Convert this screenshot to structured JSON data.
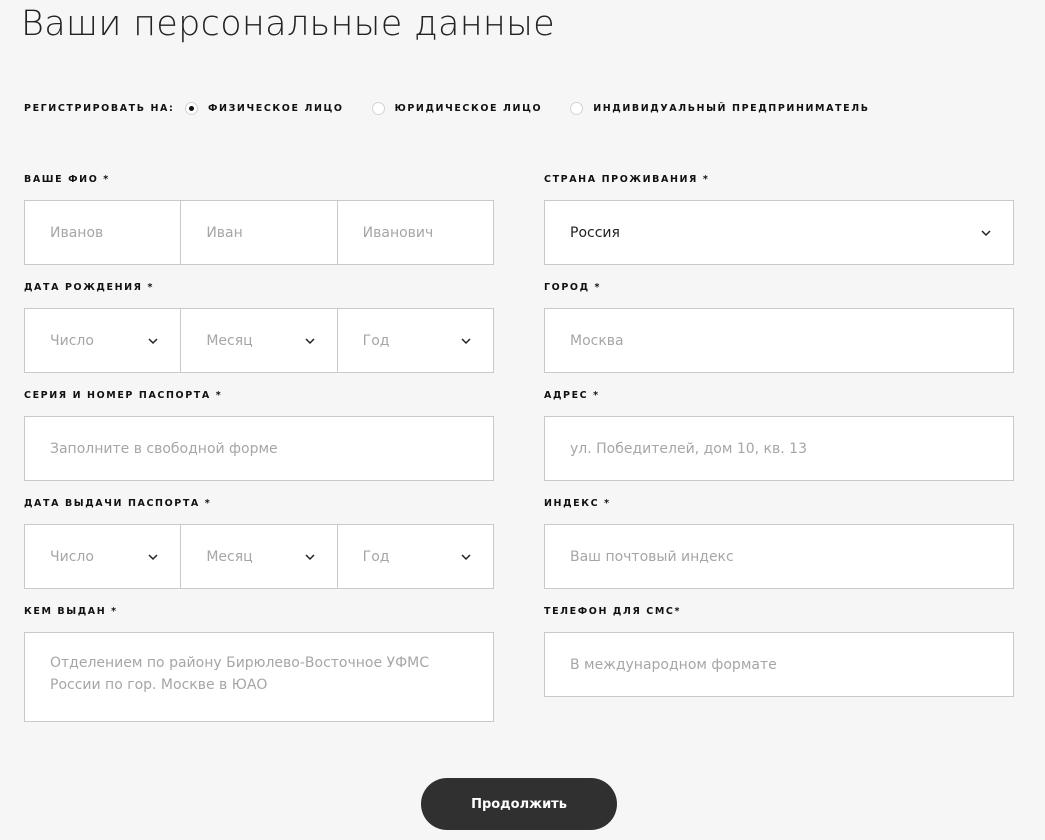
{
  "title": "Ваши персональные данные",
  "registration": {
    "label": "Регистрировать на:",
    "options": [
      {
        "label": "Физическое лицо",
        "checked": true
      },
      {
        "label": "Юридическое лицо",
        "checked": false
      },
      {
        "label": "Индивидуальный предприниматель",
        "checked": false
      }
    ]
  },
  "left": {
    "fio": {
      "label": "Ваше ФИО *",
      "last_name_placeholder": "Иванов",
      "first_name_placeholder": "Иван",
      "middle_name_placeholder": "Иванович"
    },
    "birth_date": {
      "label": "Дата рождения *",
      "day_placeholder": "Число",
      "month_placeholder": "Месяц",
      "year_placeholder": "Год"
    },
    "passport": {
      "label": "Серия и номер паспорта *",
      "placeholder": "Заполните в свободной форме"
    },
    "passport_date": {
      "label": "Дата выдачи паспорта *",
      "day_placeholder": "Число",
      "month_placeholder": "Месяц",
      "year_placeholder": "Год"
    },
    "issued_by": {
      "label": "Кем выдан *",
      "placeholder": "Отделением по району Бирюлево-Восточное УФМС России по гор. Москве в ЮАО"
    }
  },
  "right": {
    "country": {
      "label": "Страна проживания *",
      "value": "Россия"
    },
    "city": {
      "label": "Город *",
      "placeholder": "Москва"
    },
    "address": {
      "label": "Адрес *",
      "placeholder": "ул. Победителей, дом 10, кв. 13"
    },
    "postcode": {
      "label": "Индекс *",
      "placeholder": "Ваш почтовый индекс"
    },
    "phone": {
      "label": "Телефон для СМС*",
      "placeholder": "В международном формате"
    }
  },
  "submit_label": "Продолжить",
  "icons": {
    "dropdown": "chevron-down-icon"
  }
}
